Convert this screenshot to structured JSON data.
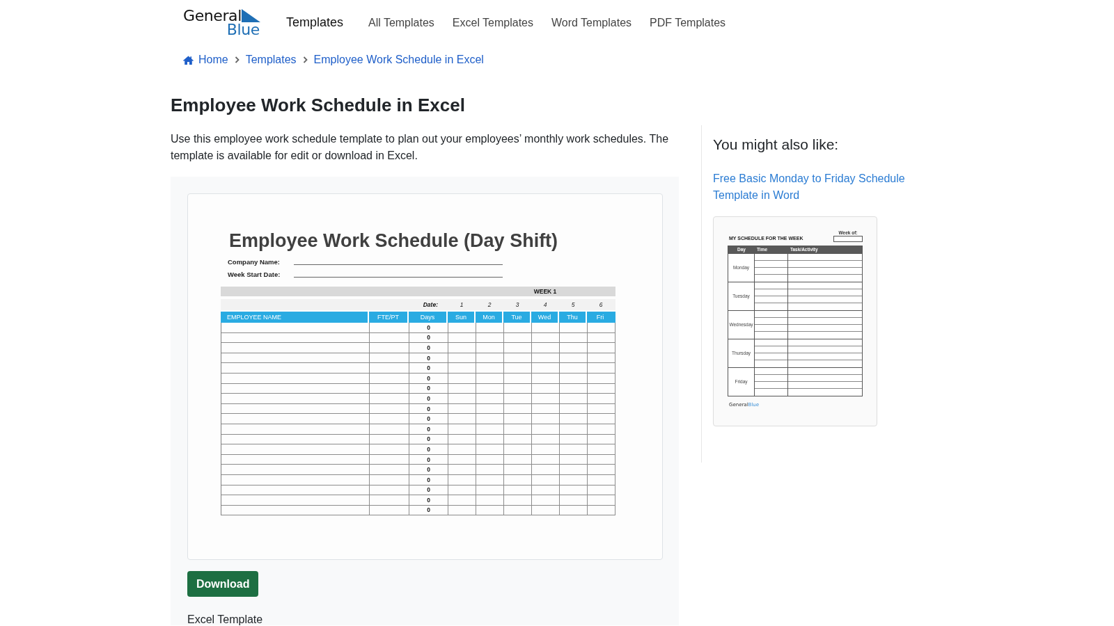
{
  "header": {
    "logo": {
      "top": "General",
      "bottom": "Blue"
    },
    "brand": "Templates",
    "nav": [
      "All Templates",
      "Excel Templates",
      "Word Templates",
      "PDF Templates"
    ]
  },
  "breadcrumb": [
    {
      "kind": "home",
      "label": "Home"
    },
    {
      "kind": "link",
      "label": "Templates"
    },
    {
      "kind": "link",
      "label": "Employee Work Schedule in Excel"
    }
  ],
  "page": {
    "title": "Employee Work Schedule in Excel",
    "description": "Use this employee work schedule template to plan out your employees’ monthly work schedules. The template is available for edit or download in Excel."
  },
  "preview": {
    "document": {
      "title": "Employee Work Schedule (Day Shift)",
      "fields": [
        "Company Name:",
        "Week Start Date:"
      ],
      "week_label": "WEEK 1",
      "date_label": "Date:",
      "dates": [
        "1",
        "2",
        "3",
        "4",
        "5",
        "6"
      ],
      "columns": [
        "EMPLOYEE NAME",
        "FTE/PT",
        "Days",
        "Sun",
        "Mon",
        "Tue",
        "Wed",
        "Thu",
        "Fri"
      ],
      "rows": [
        {
          "days": "0"
        },
        {
          "days": "0"
        },
        {
          "days": "0"
        },
        {
          "days": "0"
        },
        {
          "days": "0"
        },
        {
          "days": "0"
        },
        {
          "days": "0"
        },
        {
          "days": "0"
        },
        {
          "days": "0"
        },
        {
          "days": "0"
        },
        {
          "days": "0"
        },
        {
          "days": "0"
        },
        {
          "days": "0"
        },
        {
          "days": "0"
        },
        {
          "days": "0"
        },
        {
          "days": "0"
        },
        {
          "days": "0"
        },
        {
          "days": "0"
        },
        {
          "days": "0"
        }
      ]
    },
    "download_button": "Download",
    "file_type": "Excel Template"
  },
  "sidebar": {
    "heading": "You might also like:",
    "related": [
      {
        "title": "Free Basic Monday to Friday Schedule Template in Word",
        "thumbnail": {
          "title": "MY SCHEDULE FOR THE WEEK",
          "week_label": "Week of:",
          "columns": [
            "Day",
            "Time",
            "Task/Activity"
          ],
          "days": [
            "Monday",
            "Tuesday",
            "Wednesday",
            "Thursday",
            "Friday"
          ],
          "brand": {
            "top": "General",
            "bottom": "Blue"
          }
        }
      }
    ]
  }
}
